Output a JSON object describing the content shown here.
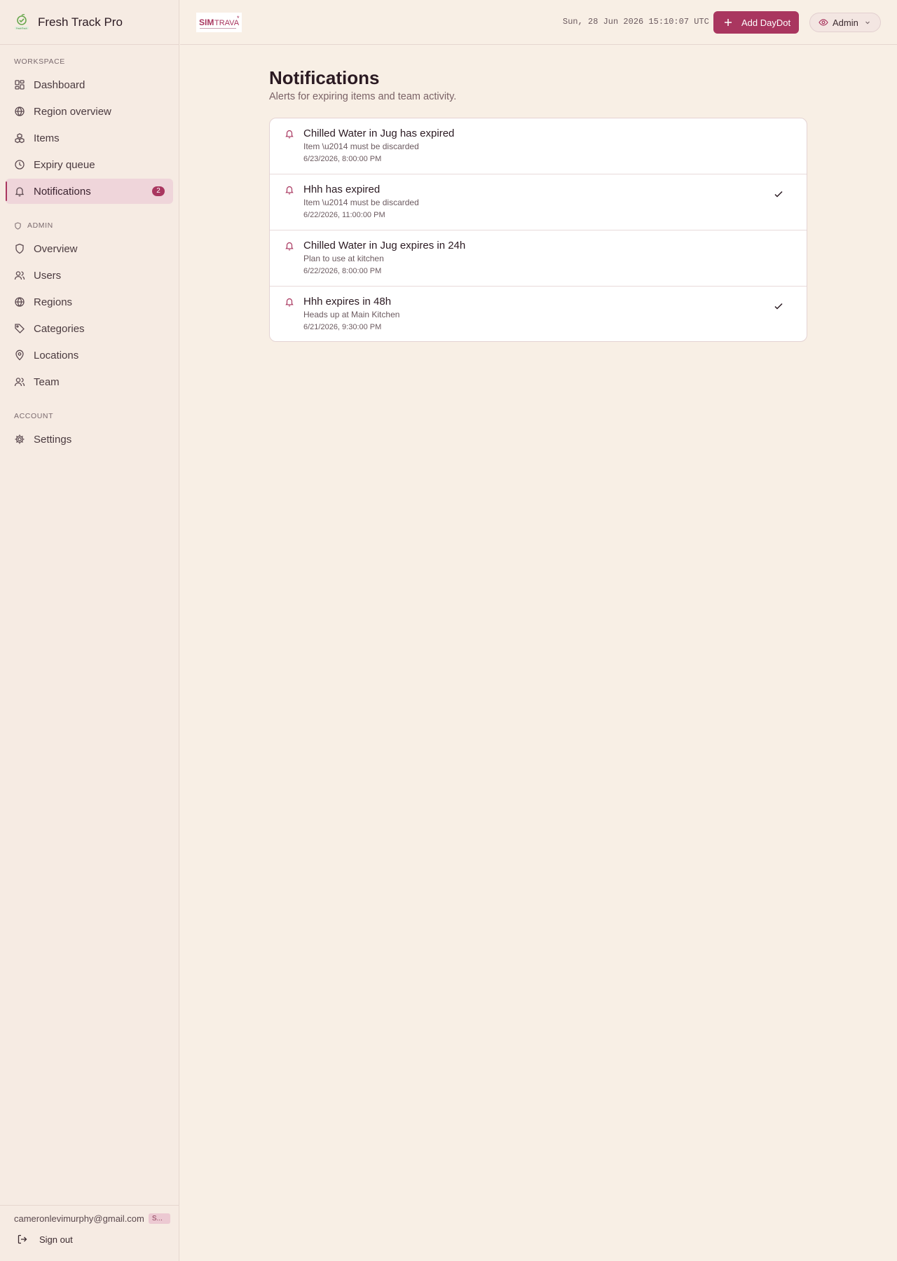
{
  "app": {
    "name": "Fresh Track Pro",
    "logo_caption": "FreshTrack"
  },
  "org_logo": {
    "text_bold": "SIM",
    "text_light": "TRAVA",
    "mark": "*"
  },
  "header": {
    "clock": "Sun, 28 Jun 2026 15:10:07 UTC",
    "add_button_label": "Add DayDot",
    "role_label": "Admin"
  },
  "sidebar": {
    "workspace_label": "WORKSPACE",
    "workspace_items": [
      {
        "label": "Dashboard",
        "icon": "dashboard-icon"
      },
      {
        "label": "Region overview",
        "icon": "globe-icon"
      },
      {
        "label": "Items",
        "icon": "boxes-icon"
      },
      {
        "label": "Expiry queue",
        "icon": "clock-icon"
      },
      {
        "label": "Notifications",
        "icon": "bell-icon",
        "badge": "2",
        "active": true
      }
    ],
    "admin_label": "ADMIN",
    "admin_items": [
      {
        "label": "Overview",
        "icon": "shield-icon"
      },
      {
        "label": "Users",
        "icon": "users-icon"
      },
      {
        "label": "Regions",
        "icon": "globe-icon"
      },
      {
        "label": "Categories",
        "icon": "tag-icon"
      },
      {
        "label": "Locations",
        "icon": "map-pin-icon"
      },
      {
        "label": "Team",
        "icon": "users-icon"
      }
    ],
    "account_label": "ACCOUNT",
    "account_items": [
      {
        "label": "Settings",
        "icon": "gear-icon"
      }
    ],
    "footer": {
      "email": "cameronlevimurphy@gmail.com",
      "role_chip": "S...",
      "signout_label": "Sign out"
    }
  },
  "main": {
    "title": "Notifications",
    "subtitle": "Alerts for expiring items and team activity.",
    "notifications": [
      {
        "title": "Chilled Water in Jug has expired",
        "message": "Item \\u2014 must be discarded",
        "time": "6/23/2026, 8:00:00 PM",
        "read": false
      },
      {
        "title": "Hhh has expired",
        "message": "Item \\u2014 must be discarded",
        "time": "6/22/2026, 11:00:00 PM",
        "read": true
      },
      {
        "title": "Chilled Water in Jug expires in 24h",
        "message": "Plan to use at kitchen",
        "time": "6/22/2026, 8:00:00 PM",
        "read": false
      },
      {
        "title": "Hhh expires in 48h",
        "message": "Heads up at Main Kitchen",
        "time": "6/21/2026, 9:30:00 PM",
        "read": true
      }
    ]
  },
  "colors": {
    "accent": "#a9365f",
    "background": "#f8efe5",
    "sidebar": "#f6ebe3",
    "active_nav": "#efd5da"
  }
}
